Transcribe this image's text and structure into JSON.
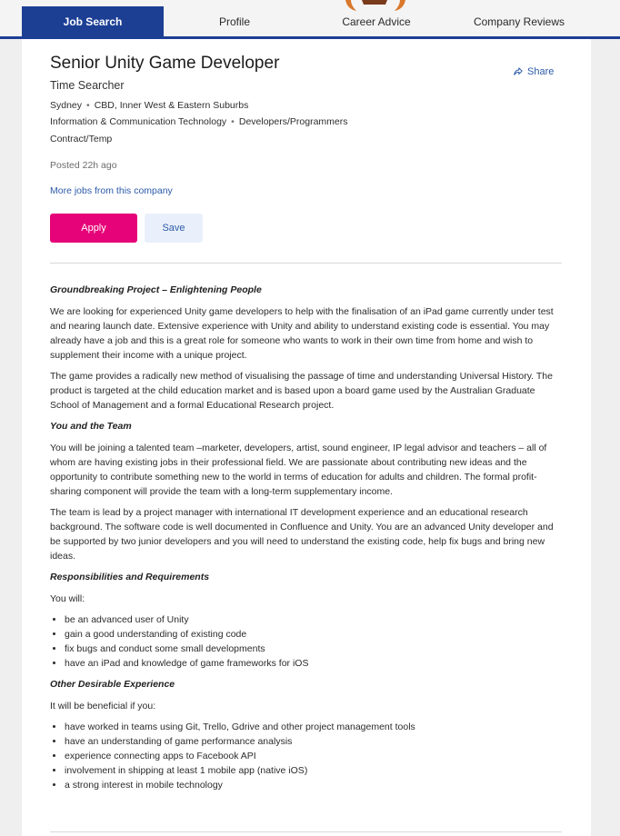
{
  "nav": {
    "tabs": [
      {
        "label": "Job Search",
        "active": true
      },
      {
        "label": "Profile",
        "active": false
      },
      {
        "label": "Career Advice",
        "active": false
      },
      {
        "label": "Company Reviews",
        "active": false
      }
    ]
  },
  "job": {
    "title": "Senior Unity Game Developer",
    "company": "Time Searcher",
    "location": "Sydney",
    "area": "CBD, Inner West & Eastern Suburbs",
    "classification": "Information & Communication Technology",
    "subclassification": "Developers/Programmers",
    "work_type": "Contract/Temp",
    "posted": "Posted 22h ago",
    "more_jobs": "More jobs from this company",
    "share": "Share",
    "apply": "Apply",
    "save": "Save"
  },
  "description": {
    "h1": "Groundbreaking Project – Enlightening People",
    "p1": "We are looking for experienced Unity game developers to help with the finalisation of an iPad game currently under test and nearing launch date.  Extensive experience with Unity and ability to understand existing code is essential. You may already have a job and this is a great role for someone who wants to work in their own time from home and wish to supplement their income with a unique project.",
    "p2": "The game provides a radically new method of visualising the passage of time and understanding Universal History.  The product is targeted at the child education market and is based upon a board game used by the Australian Graduate School of Management and a formal Educational Research project.",
    "h2": "You and the Team",
    "p3": "You will be joining a talented team –marketer, developers, artist, sound engineer, IP legal advisor and teachers – all of whom are having existing jobs in their professional field.  We are passionate about contributing new ideas and the opportunity to contribute something new to the world in terms of education for adults and children.  The formal profit-sharing component will provide the team with a long-term supplementary income.",
    "p4": "The team is lead by a project manager with international IT development experience and an educational research background.  The software code is well documented in Confluence and Unity.  You are an advanced Unity developer and be supported by two junior developers and you will need to understand the existing code, help fix bugs and bring new ideas.",
    "h3": "Responsibilities and Requirements",
    "p5": "You will:",
    "list1": [
      "be an advanced user of Unity",
      "gain a good understanding of existing code",
      "fix bugs and conduct some small developments",
      "have an iPad and knowledge of game frameworks for iOS"
    ],
    "h4": "Other Desirable Experience",
    "p6": "It will be beneficial if you:",
    "list2": [
      "have worked in teams using Git, Trello, Gdrive and other project management tools",
      "have an understanding of game performance analysis",
      "experience connecting apps to Facebook API",
      "involvement in shipping at least 1 mobile app (native iOS)",
      "a strong interest in mobile technology"
    ]
  },
  "colors": {
    "brand_blue": "#1c3f94",
    "apply_pink": "#e60278",
    "link_blue": "#2c5aa8"
  },
  "icons": {
    "share": "share-arrow-icon",
    "mascot": "mascot-icon"
  }
}
